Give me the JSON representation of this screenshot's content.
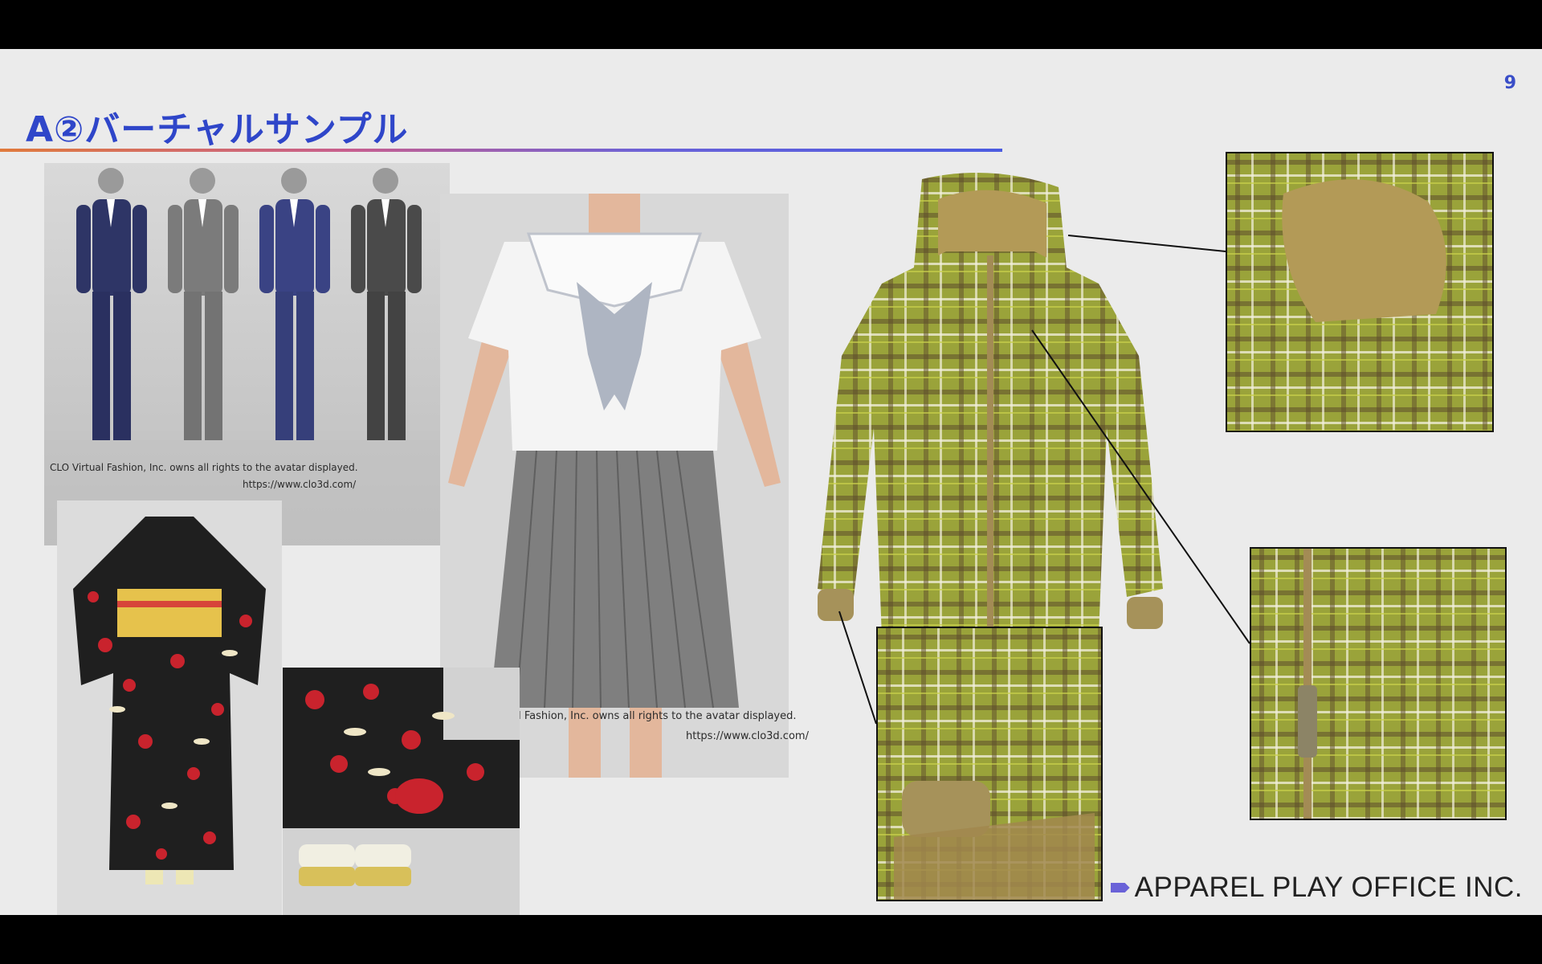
{
  "slide": {
    "page_number": "9",
    "title": "A②バーチャルサンプル",
    "credits": {
      "suits_rights": "CLO Virtual Fashion, Inc. owns all rights to the avatar displayed.",
      "suits_url": "https://www.clo3d.com/",
      "uniform_rights": "CLO Virtual Fashion, Inc. owns all rights to the avatar displayed.",
      "uniform_url": "https://www.clo3d.com/"
    },
    "footer": "APPAREL PLAY OFFICE INC."
  },
  "colors": {
    "title": "#2f46c9",
    "accent_purple": "#6a62d8",
    "plaid_green": "#9aa33a",
    "suit_navy": "#2e3566",
    "suit_gray": "#7b7b7b",
    "kimono_black": "#1f1f1f",
    "kimono_red": "#c9232d"
  },
  "images": {
    "suits": "four-suit-avatars-image",
    "uniform": "sailor-uniform-avatar-image",
    "kimono_full": "kimono-full-image",
    "kimono_detail": "kimono-detail-image",
    "jacket": "plaid-hooded-jacket-image",
    "zoom_hood": "hood-closeup-image",
    "zoom_cuff": "cuff-closeup-image",
    "zoom_zip": "zipper-closeup-image"
  }
}
